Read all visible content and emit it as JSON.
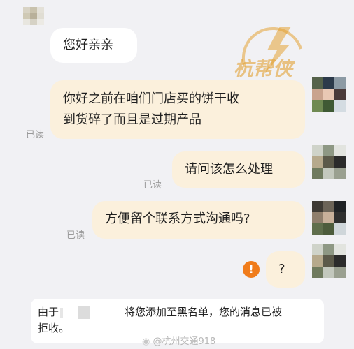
{
  "messages": [
    {
      "side": "left",
      "text": "您好亲亲"
    },
    {
      "side": "right",
      "line1": "你好之前在咱们门店买的饼干收",
      "line2": "到货碎了而且是过期产品",
      "status": "已读"
    },
    {
      "side": "right",
      "text": "请问该怎么处理",
      "status": "已读"
    },
    {
      "side": "right",
      "text": "方便留个联系方式沟通吗?",
      "status": "已读"
    },
    {
      "side": "right",
      "text": "?",
      "error_icon": "!"
    }
  ],
  "notice": {
    "prefix": "由于",
    "middle": "将您添加至黑名单，您的消息已被",
    "suffix": "拒收。"
  },
  "watermark": {
    "logo_text": "杭帮侠",
    "weibo_text": "@杭州交通918",
    "weibo_icon": "weibo-icon"
  },
  "colors": {
    "background": "#f1f1f4",
    "sent_bubble": "#fbf0dc",
    "received_bubble": "#ffffff",
    "warning": "#f07c1b",
    "watermark": "#e3a235"
  }
}
